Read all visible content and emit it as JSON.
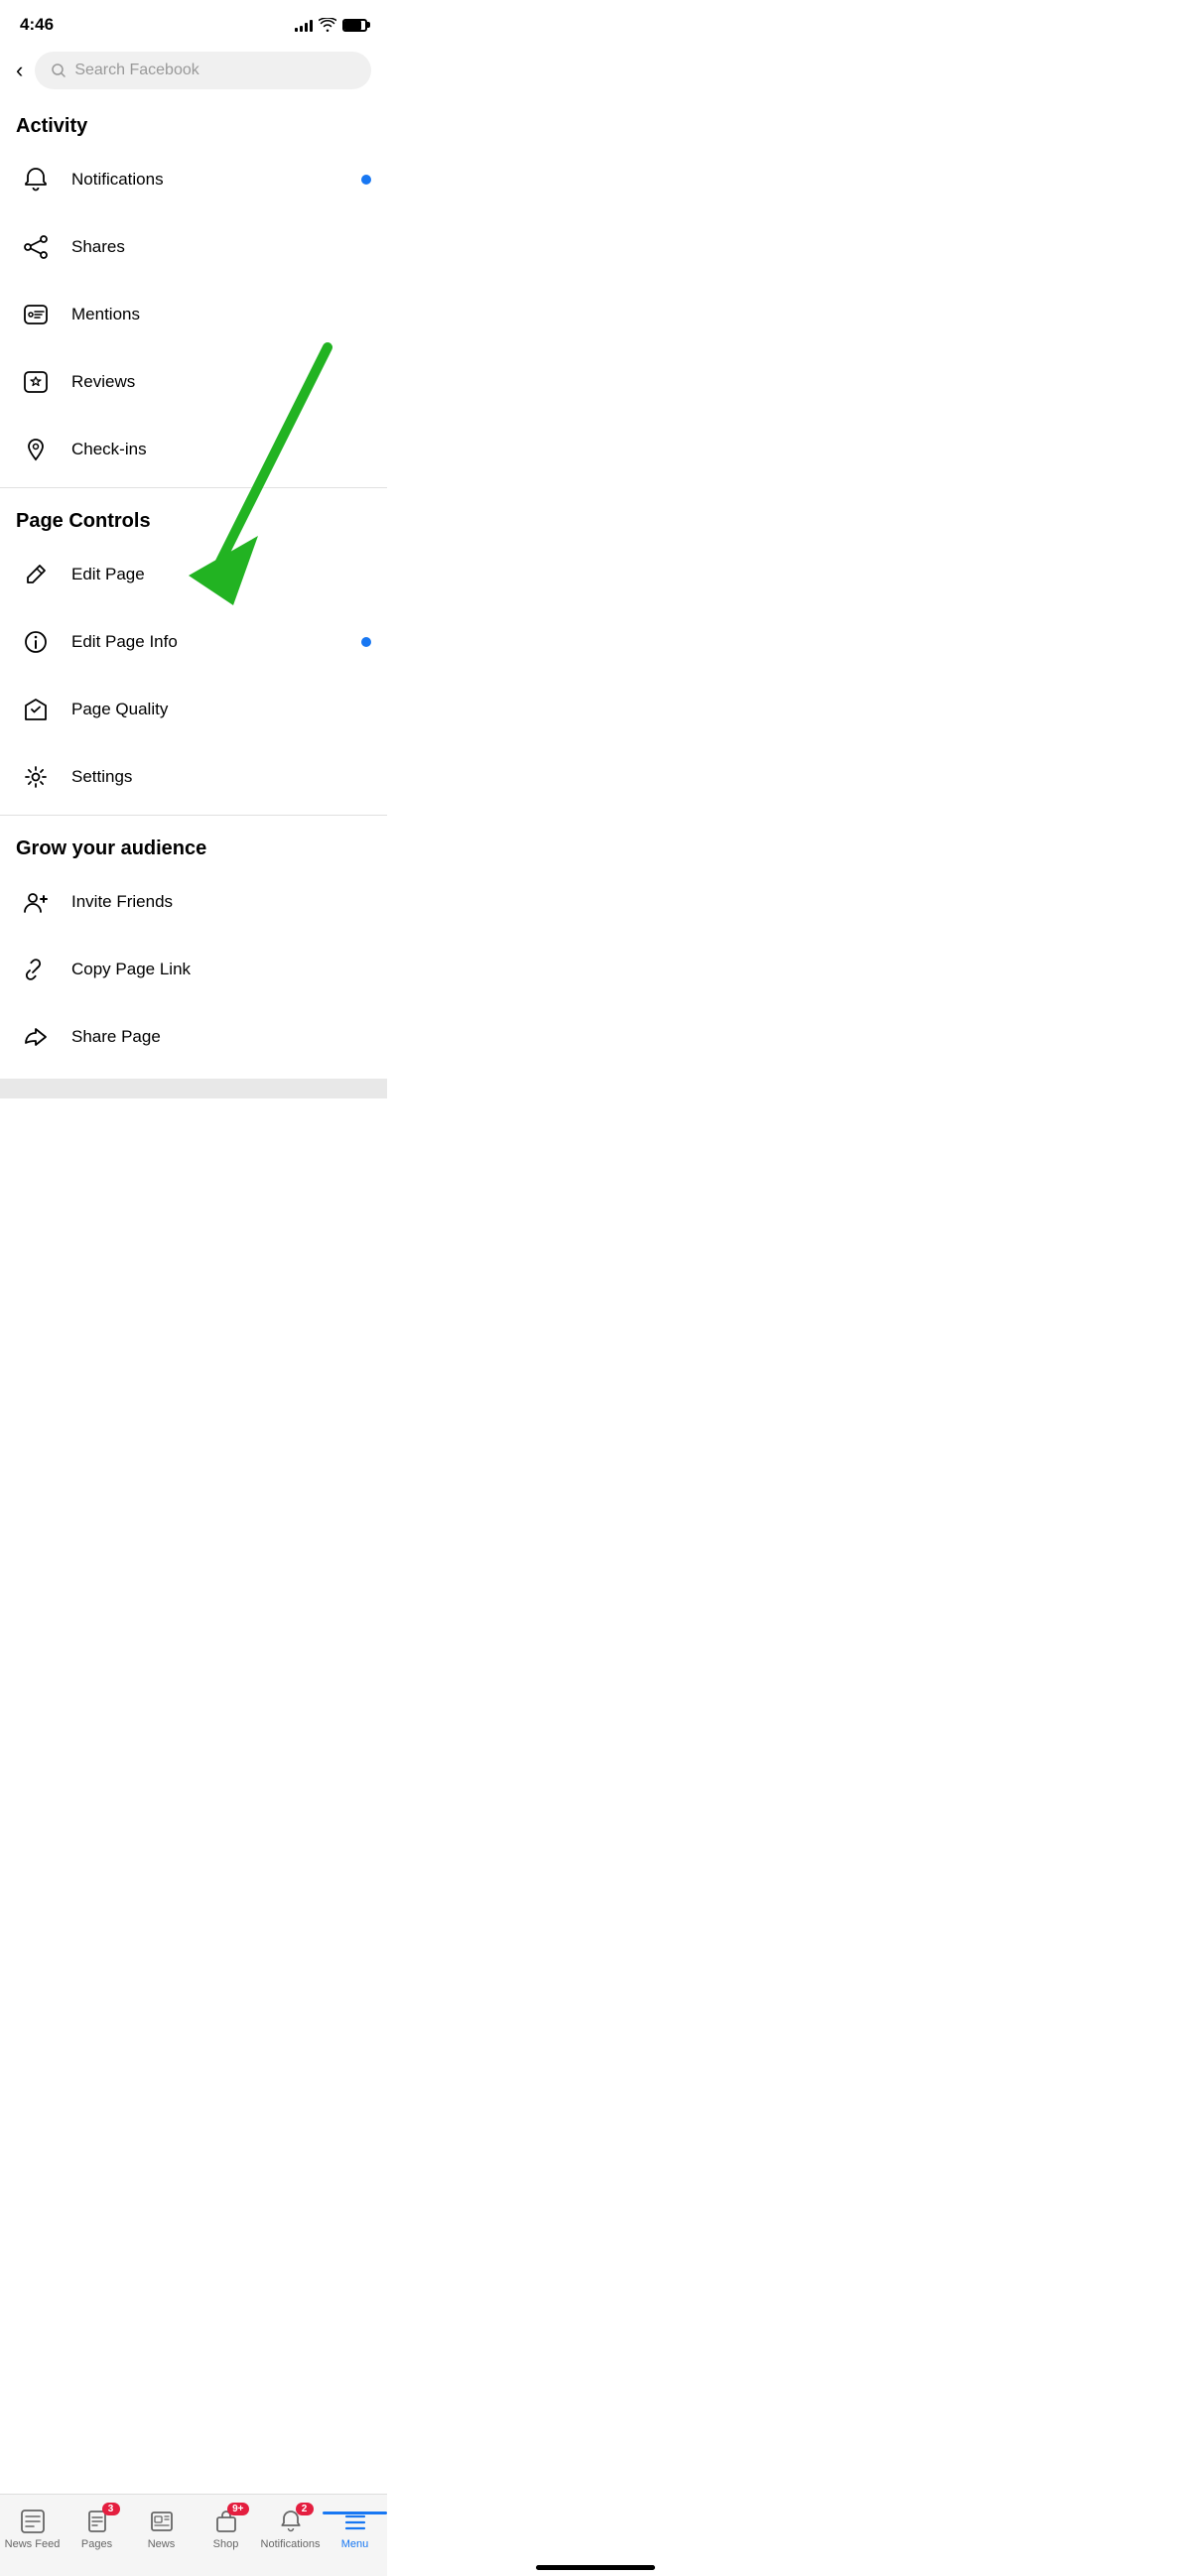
{
  "statusBar": {
    "time": "4:46",
    "signalBars": [
      4,
      6,
      8,
      10
    ],
    "battery": 80
  },
  "searchBar": {
    "backLabel": "‹",
    "placeholder": "Search Facebook"
  },
  "sections": [
    {
      "title": "Activity",
      "items": [
        {
          "id": "notifications",
          "label": "Notifications",
          "badge": true
        },
        {
          "id": "shares",
          "label": "Shares",
          "badge": false
        },
        {
          "id": "mentions",
          "label": "Mentions",
          "badge": false
        },
        {
          "id": "reviews",
          "label": "Reviews",
          "badge": false
        },
        {
          "id": "checkins",
          "label": "Check-ins",
          "badge": false
        }
      ]
    },
    {
      "title": "Page Controls",
      "items": [
        {
          "id": "edit-page",
          "label": "Edit Page",
          "badge": false
        },
        {
          "id": "edit-page-info",
          "label": "Edit Page Info",
          "badge": true
        },
        {
          "id": "page-quality",
          "label": "Page Quality",
          "badge": false
        },
        {
          "id": "settings",
          "label": "Settings",
          "badge": false
        }
      ]
    },
    {
      "title": "Grow your audience",
      "items": [
        {
          "id": "invite-friends",
          "label": "Invite Friends",
          "badge": false
        },
        {
          "id": "copy-page-link",
          "label": "Copy Page Link",
          "badge": false
        },
        {
          "id": "share-page",
          "label": "Share Page",
          "badge": false
        }
      ]
    }
  ],
  "tabBar": {
    "items": [
      {
        "id": "news-feed",
        "label": "News Feed",
        "active": false,
        "badge": null
      },
      {
        "id": "pages",
        "label": "Pages",
        "active": false,
        "badge": "3"
      },
      {
        "id": "news",
        "label": "News",
        "active": false,
        "badge": null
      },
      {
        "id": "shop",
        "label": "Shop",
        "active": false,
        "badge": "9+"
      },
      {
        "id": "notifications-tab",
        "label": "Notifications",
        "active": false,
        "badge": "2"
      },
      {
        "id": "menu",
        "label": "Menu",
        "active": true,
        "badge": null
      }
    ]
  }
}
